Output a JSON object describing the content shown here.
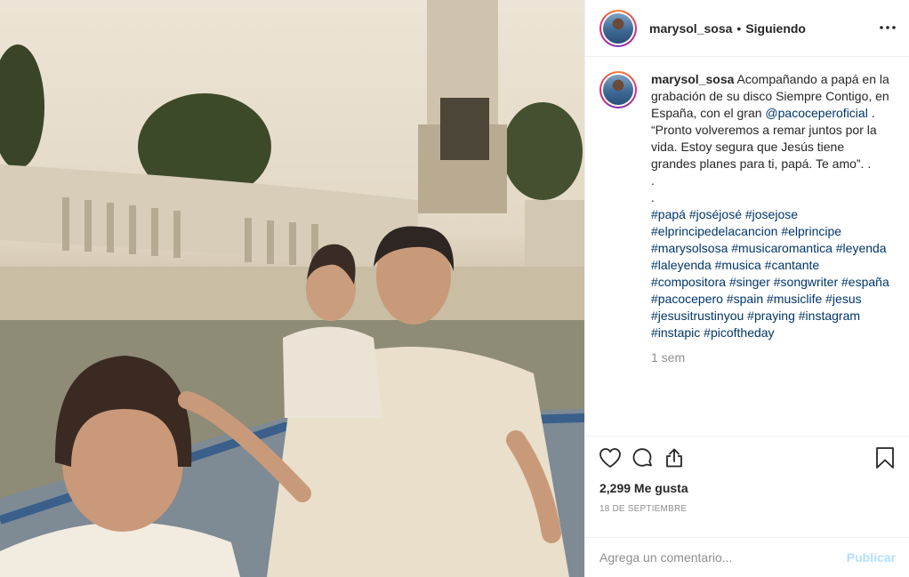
{
  "post": {
    "username": "marysol_sosa",
    "follow_separator": "•",
    "follow_status": "Siguiendo",
    "more_icon": "more-horizontal-icon",
    "photo_alt": "Foto de marysol_sosa"
  },
  "caption": {
    "username": "marysol_sosa",
    "text_before_mention": "Acompañando a papá en la grabación de su disco Siempre Contigo, en España, con el gran ",
    "mention": "@pacoceperoficial",
    "text_after_mention": " . “Pronto volveremos a remar juntos por la vida. Estoy segura que Jesús tiene grandes planes para ti, papá. Te amo”. .",
    "dot_line_1": ".",
    "dot_line_2": ".",
    "hashtags": [
      "#papá",
      "#joséjosé",
      "#josejose",
      "#elprincipedelacancion",
      "#elprincipe",
      "#marysolsosa",
      "#musicaromantica",
      "#leyenda",
      "#laleyenda",
      "#musica",
      "#cantante",
      "#compositora",
      "#singer",
      "#songwriter",
      "#españa",
      "#pacocepero",
      "#spain",
      "#musiclife",
      "#jesus",
      "#jesusitrustinyou",
      "#praying",
      "#instagram",
      "#instapic",
      "#picoftheday"
    ],
    "time": "1 sem"
  },
  "actions": {
    "like_icon": "heart-icon",
    "comment_icon": "comment-icon",
    "share_icon": "share-icon",
    "save_icon": "bookmark-icon",
    "likes_text": "2,299 Me gusta",
    "date": "18 DE SEPTIEMBRE"
  },
  "comment_box": {
    "placeholder": "Agrega un comentario...",
    "publish_label": "Publicar"
  },
  "colors": {
    "link": "#003569",
    "muted": "#8e8e8e",
    "publish_disabled": "#b2dffc",
    "border": "#efefef"
  }
}
